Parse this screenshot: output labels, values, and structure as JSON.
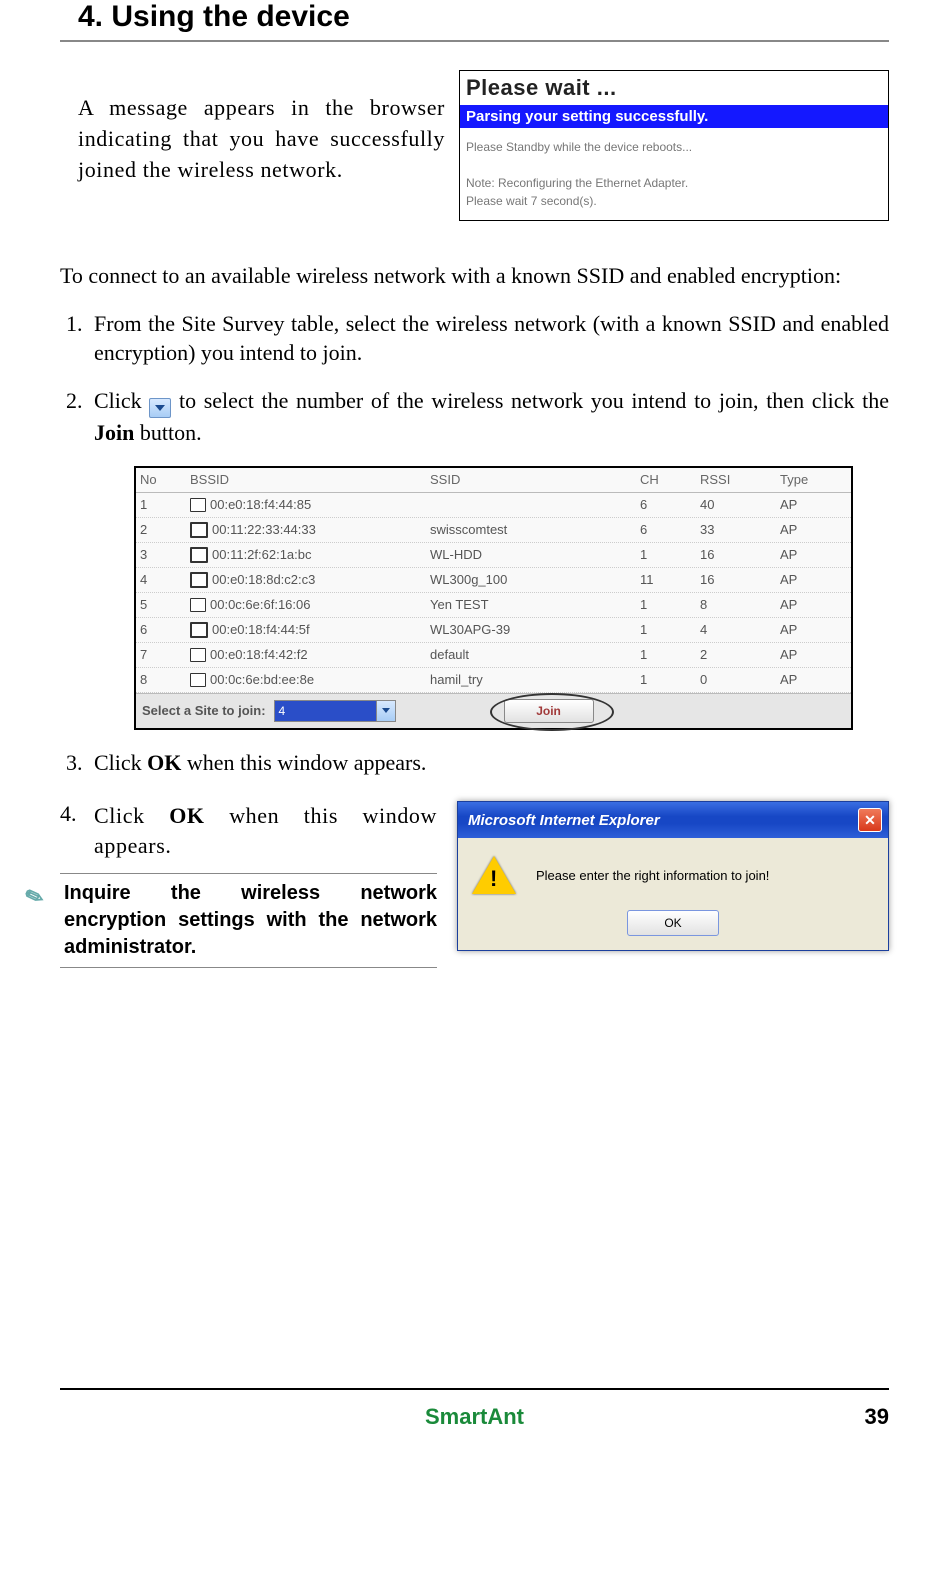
{
  "chapter_title": "4. Using the device",
  "intro_para": "A message appears in the browser indicating that you have successfully joined the wireless network.",
  "waitbox": {
    "title": "Please wait ...",
    "bar": "Parsing your setting successfully.",
    "line1": "Please Standby while the device reboots...",
    "line2": "Note: Reconfiguring the Ethernet Adapter.",
    "line3": "Please wait 7 second(s)."
  },
  "para2": "To connect to an available wireless network with a known SSID and enabled encryption:",
  "step1": "From the Site Survey table, select the wireless network (with a known SSID and enabled encryption) you intend to join.",
  "step2_a": "Click ",
  "step2_b": " to select the number of the wireless network you intend to join, then click the ",
  "step2_join": "Join",
  "step2_c": " button.",
  "survey": {
    "headers": {
      "no": "No",
      "bssid": "BSSID",
      "ssid": "SSID",
      "ch": "CH",
      "rssi": "RSSI",
      "type": "Type"
    },
    "rows": [
      {
        "no": "1",
        "bssid": "00:e0:18:f4:44:85",
        "ssid": "",
        "ch": "6",
        "rssi": "40",
        "type": "AP",
        "bold": false
      },
      {
        "no": "2",
        "bssid": "00:11:22:33:44:33",
        "ssid": "swisscomtest",
        "ch": "6",
        "rssi": "33",
        "type": "AP",
        "bold": true
      },
      {
        "no": "3",
        "bssid": "00:11:2f:62:1a:bc",
        "ssid": "WL-HDD",
        "ch": "1",
        "rssi": "16",
        "type": "AP",
        "bold": true
      },
      {
        "no": "4",
        "bssid": "00:e0:18:8d:c2:c3",
        "ssid": "WL300g_100",
        "ch": "11",
        "rssi": "16",
        "type": "AP",
        "bold": true
      },
      {
        "no": "5",
        "bssid": "00:0c:6e:6f:16:06",
        "ssid": "Yen TEST",
        "ch": "1",
        "rssi": "8",
        "type": "AP",
        "bold": false
      },
      {
        "no": "6",
        "bssid": "00:e0:18:f4:44:5f",
        "ssid": "WL30APG-39",
        "ch": "1",
        "rssi": "4",
        "type": "AP",
        "bold": true
      },
      {
        "no": "7",
        "bssid": "00:e0:18:f4:42:f2",
        "ssid": "default",
        "ch": "1",
        "rssi": "2",
        "type": "AP",
        "bold": false
      },
      {
        "no": "8",
        "bssid": "00:0c:6e:bd:ee:8e",
        "ssid": "hamil_try",
        "ch": "1",
        "rssi": "0",
        "type": "AP",
        "bold": false
      }
    ],
    "footer_label": "Select a Site to join:",
    "selected": "4",
    "join_btn": "Join"
  },
  "step3_a": "Click ",
  "step3_ok": "OK",
  "step3_b": " when this window appears.",
  "step4_num": "4.",
  "step4_a": "Click ",
  "step4_ok": "OK",
  "step4_b": " when this window appears.",
  "note_text": "Inquire the wireless network encryption settings with the network administrator.",
  "iedlg": {
    "title": "Microsoft Internet Explorer",
    "msg": "Please enter the right information to join!",
    "ok": "OK"
  },
  "footer": {
    "brand": "SmartAnt",
    "page": "39"
  }
}
